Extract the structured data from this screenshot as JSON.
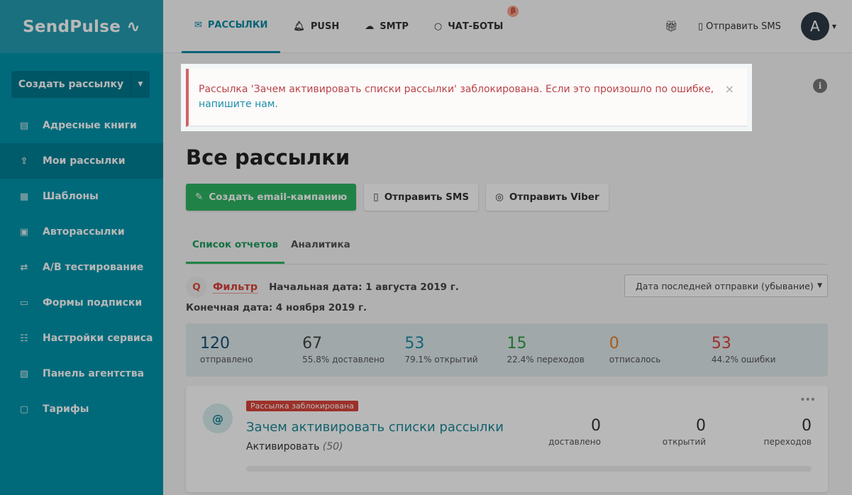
{
  "logo": "SendPulse",
  "sidebar": {
    "create_label": "Создать рассылку",
    "items": [
      {
        "label": "Адресные книги",
        "icon": "address-book-icon"
      },
      {
        "label": "Мои рассылки",
        "icon": "mail-upload-icon"
      },
      {
        "label": "Шаблоны",
        "icon": "template-icon"
      },
      {
        "label": "Авторассылки",
        "icon": "automation-icon"
      },
      {
        "label": "A/B тестирование",
        "icon": "ab-test-icon"
      },
      {
        "label": "Формы подписки",
        "icon": "form-icon"
      },
      {
        "label": "Настройки сервиса",
        "icon": "settings-icon"
      },
      {
        "label": "Панель агентства",
        "icon": "briefcase-icon"
      },
      {
        "label": "Тарифы",
        "icon": "wallet-icon"
      }
    ]
  },
  "topnav": {
    "tabs": [
      "РАССЫЛКИ",
      "PUSH",
      "SMTP",
      "ЧАТ-БОТЫ"
    ],
    "beta": "β",
    "send_sms": "Отправить SMS",
    "avatar": "A"
  },
  "alert": {
    "text": "Рассылка 'Зачем активировать списки рассылки' заблокирована. Если это произошло по ошибке,",
    "link": "напишите нам.",
    "close": "×"
  },
  "page": {
    "title": "Все рассылки",
    "buttons": [
      "Создать email-кампанию",
      "Отправить SMS",
      "Отправить Viber"
    ],
    "tabs": [
      "Список отчетов",
      "Аналитика"
    ],
    "filter": "Фильтр",
    "start_date": "Начальная дата: 1 августа 2019 г.",
    "end_date": "Конечная дата: 4 ноября 2019 г.",
    "sort": "Дата последней отправки (убывание)"
  },
  "stats": [
    {
      "n": "120",
      "l": "отправлено",
      "color": "#1b4f72"
    },
    {
      "n": "67",
      "l": "55.8% доставлено",
      "color": "#444444"
    },
    {
      "n": "53",
      "l": "79.1% открытий",
      "color": "#1a8fa8"
    },
    {
      "n": "15",
      "l": "22.4% переходов",
      "color": "#2e9e3e"
    },
    {
      "n": "0",
      "l": "отписалось",
      "color": "#e67e22"
    },
    {
      "n": "53",
      "l": "44.2% ошибки",
      "color": "#d9433a"
    }
  ],
  "campaign": {
    "badge": "Рассылка заблокирована",
    "title": "Зачем активировать списки рассылки",
    "list": "Активировать",
    "count": "(50)",
    "stats": [
      {
        "n": "0",
        "l": "доставлено"
      },
      {
        "n": "0",
        "l": "открытий"
      },
      {
        "n": "0",
        "l": "переходов"
      }
    ]
  }
}
